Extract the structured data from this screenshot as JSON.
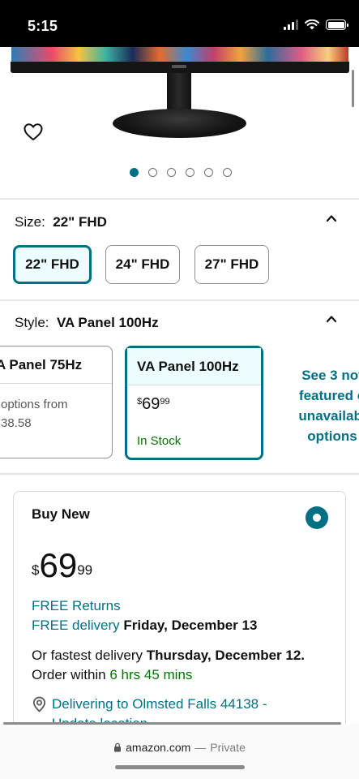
{
  "status_bar": {
    "time": "5:15",
    "icons": [
      "signal-icon",
      "wifi-icon",
      "battery-icon"
    ]
  },
  "gallery": {
    "dot_count": 6,
    "active_index": 0,
    "icons": [
      "heart-icon"
    ]
  },
  "size": {
    "label": "Size:",
    "value": "22\" FHD",
    "options": [
      {
        "label": "22\" FHD",
        "selected": true
      },
      {
        "label": "24\" FHD",
        "selected": false
      },
      {
        "label": "27\" FHD",
        "selected": false
      }
    ]
  },
  "style": {
    "label": "Style:",
    "value": "VA Panel 100Hz",
    "cards": [
      {
        "title": "A Panel 75Hz",
        "line1": "options from",
        "line2": "38.58"
      },
      {
        "title": "VA Panel 100Hz",
        "price_symbol": "$",
        "price_whole": "69",
        "price_cents": "99",
        "stock": "In Stock"
      }
    ],
    "see_more": [
      "See 3 not",
      "featured o",
      "unavailabl",
      "options"
    ]
  },
  "buy_box": {
    "title": "Buy New",
    "price_symbol": "$",
    "price_whole": "69",
    "price_cents": "99",
    "free_returns": "FREE Returns",
    "free_delivery": "FREE delivery",
    "delivery_date": "Friday, December 13",
    "fastest_prefix": "Or fastest delivery",
    "fastest_date": "Thursday, December 12.",
    "order_within_prefix": "Order within",
    "order_within_time": "6 hrs 45 mins",
    "location_line1": "Delivering to Olmsted Falls 44138 -",
    "location_line2": "Update location"
  },
  "browser": {
    "domain": "amazon.com",
    "separator": "—",
    "mode": "Private"
  },
  "colors": {
    "accent": "#007185",
    "stock_green": "#007600",
    "selected_bg": "#edfdff"
  }
}
